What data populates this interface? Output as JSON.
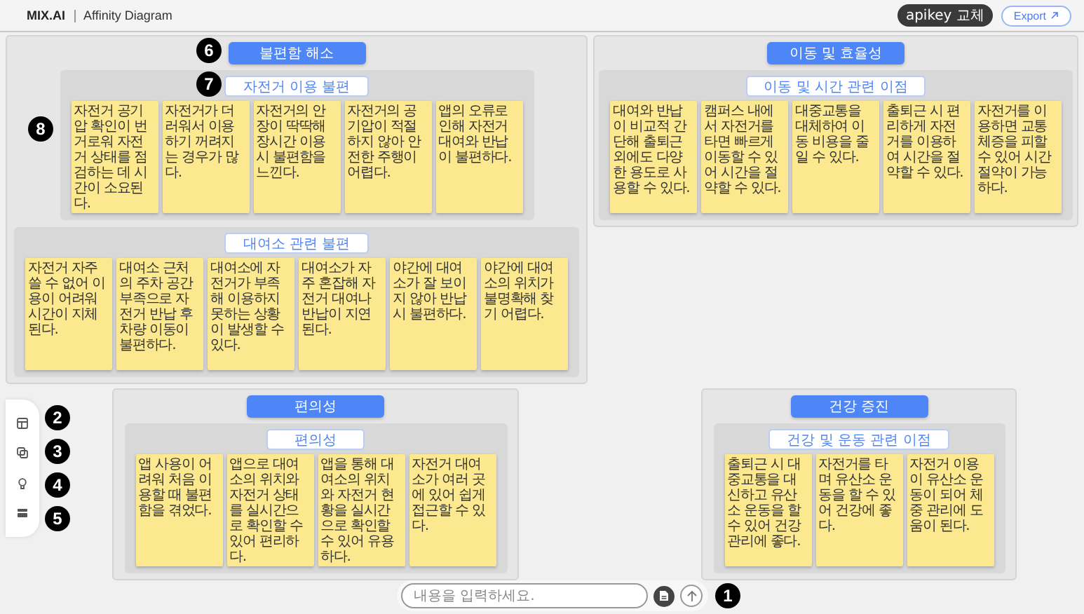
{
  "header": {
    "logo": "MIX.AI",
    "title": "Affinity Diagram",
    "apikey_button": "apikey 교체",
    "export_button": "Export"
  },
  "clusters": [
    {
      "title": "불편함 해소",
      "groups": [
        {
          "label": "자전거 이용 불편",
          "notes": [
            "자전거 공기압 확인이 번거로워 자전거 상태를 점검하는 데 시간이 소요된다.",
            "자전거가 더러워서 이용하기 꺼려지는 경우가 많다.",
            "자전거의 안장이 딱딱해 장시간 이용 시 불편함을 느낀다.",
            "자전거의 공기압이 적절하지 않아 안전한 주행이 어렵다.",
            "앱의 오류로 인해 자전거 대여와 반납이 불편하다."
          ]
        },
        {
          "label": "대여소 관련 불편",
          "notes": [
            "자전거 자주 쓸 수 없어 이용이 어려워 시간이 지체된다.",
            "대여소 근처의 주차 공간 부족으로 자전거 반납 후 차량 이동이 불편하다.",
            "대여소에 자전거가 부족해 이용하지 못하는 상황이 발생할 수 있다.",
            "대여소가 자주 혼잡해 자전거 대여나 반납이 지연된다.",
            "야간에 대여소가 잘 보이지 않아 반납 시 불편하다.",
            "야간에 대여소의 위치가 불명확해 찾기 어렵다."
          ]
        }
      ]
    },
    {
      "title": "이동 및 효율성",
      "groups": [
        {
          "label": "이동 및 시간 관련 이점",
          "notes": [
            "대여와 반납이 비교적 간단해 출퇴근 외에도 다양한 용도로 사용할 수 있다.",
            "캠퍼스 내에서 자전거를 타면 빠르게 이동할 수 있어 시간을 절약할 수 있다.",
            "대중교통을 대체하여 이동 비용을 줄일 수 있다.",
            "출퇴근 시 편리하게 자전거를 이용하여 시간을 절약할 수 있다.",
            "자전거를 이용하면 교통체증을 피할 수 있어 시간 절약이 가능하다."
          ]
        }
      ]
    },
    {
      "title": "편의성",
      "groups": [
        {
          "label": "편의성",
          "notes": [
            "앱 사용이 어려워 처음 이용할 때 불편함을 겪었다.",
            "앱으로 대여소의 위치와 자전거 상태를 실시간으로 확인할 수 있어 편리하다.",
            "앱을 통해 대여소의 위치와 자전거 현황을 실시간으로 확인할 수 있어 유용하다.",
            "자전거 대여소가 여러 곳에 있어 쉽게 접근할 수 있다."
          ]
        }
      ]
    },
    {
      "title": "건강 증진",
      "groups": [
        {
          "label": "건강 및 운동 관련 이점",
          "notes": [
            "출퇴근 시 대중교통을 대신하고 유산소 운동을 할 수 있어 건강 관리에 좋다.",
            "자전거를 타며 유산소 운동을 할 수 있어 건강에 좋다.",
            "자전거 이용이 유산소 운동이 되어 체중 관리에 도움이 된다."
          ]
        }
      ]
    }
  ],
  "chat": {
    "placeholder": "내용을 입력하세요."
  },
  "markers": [
    "6",
    "7",
    "8",
    "2",
    "3",
    "4",
    "5",
    "1"
  ]
}
